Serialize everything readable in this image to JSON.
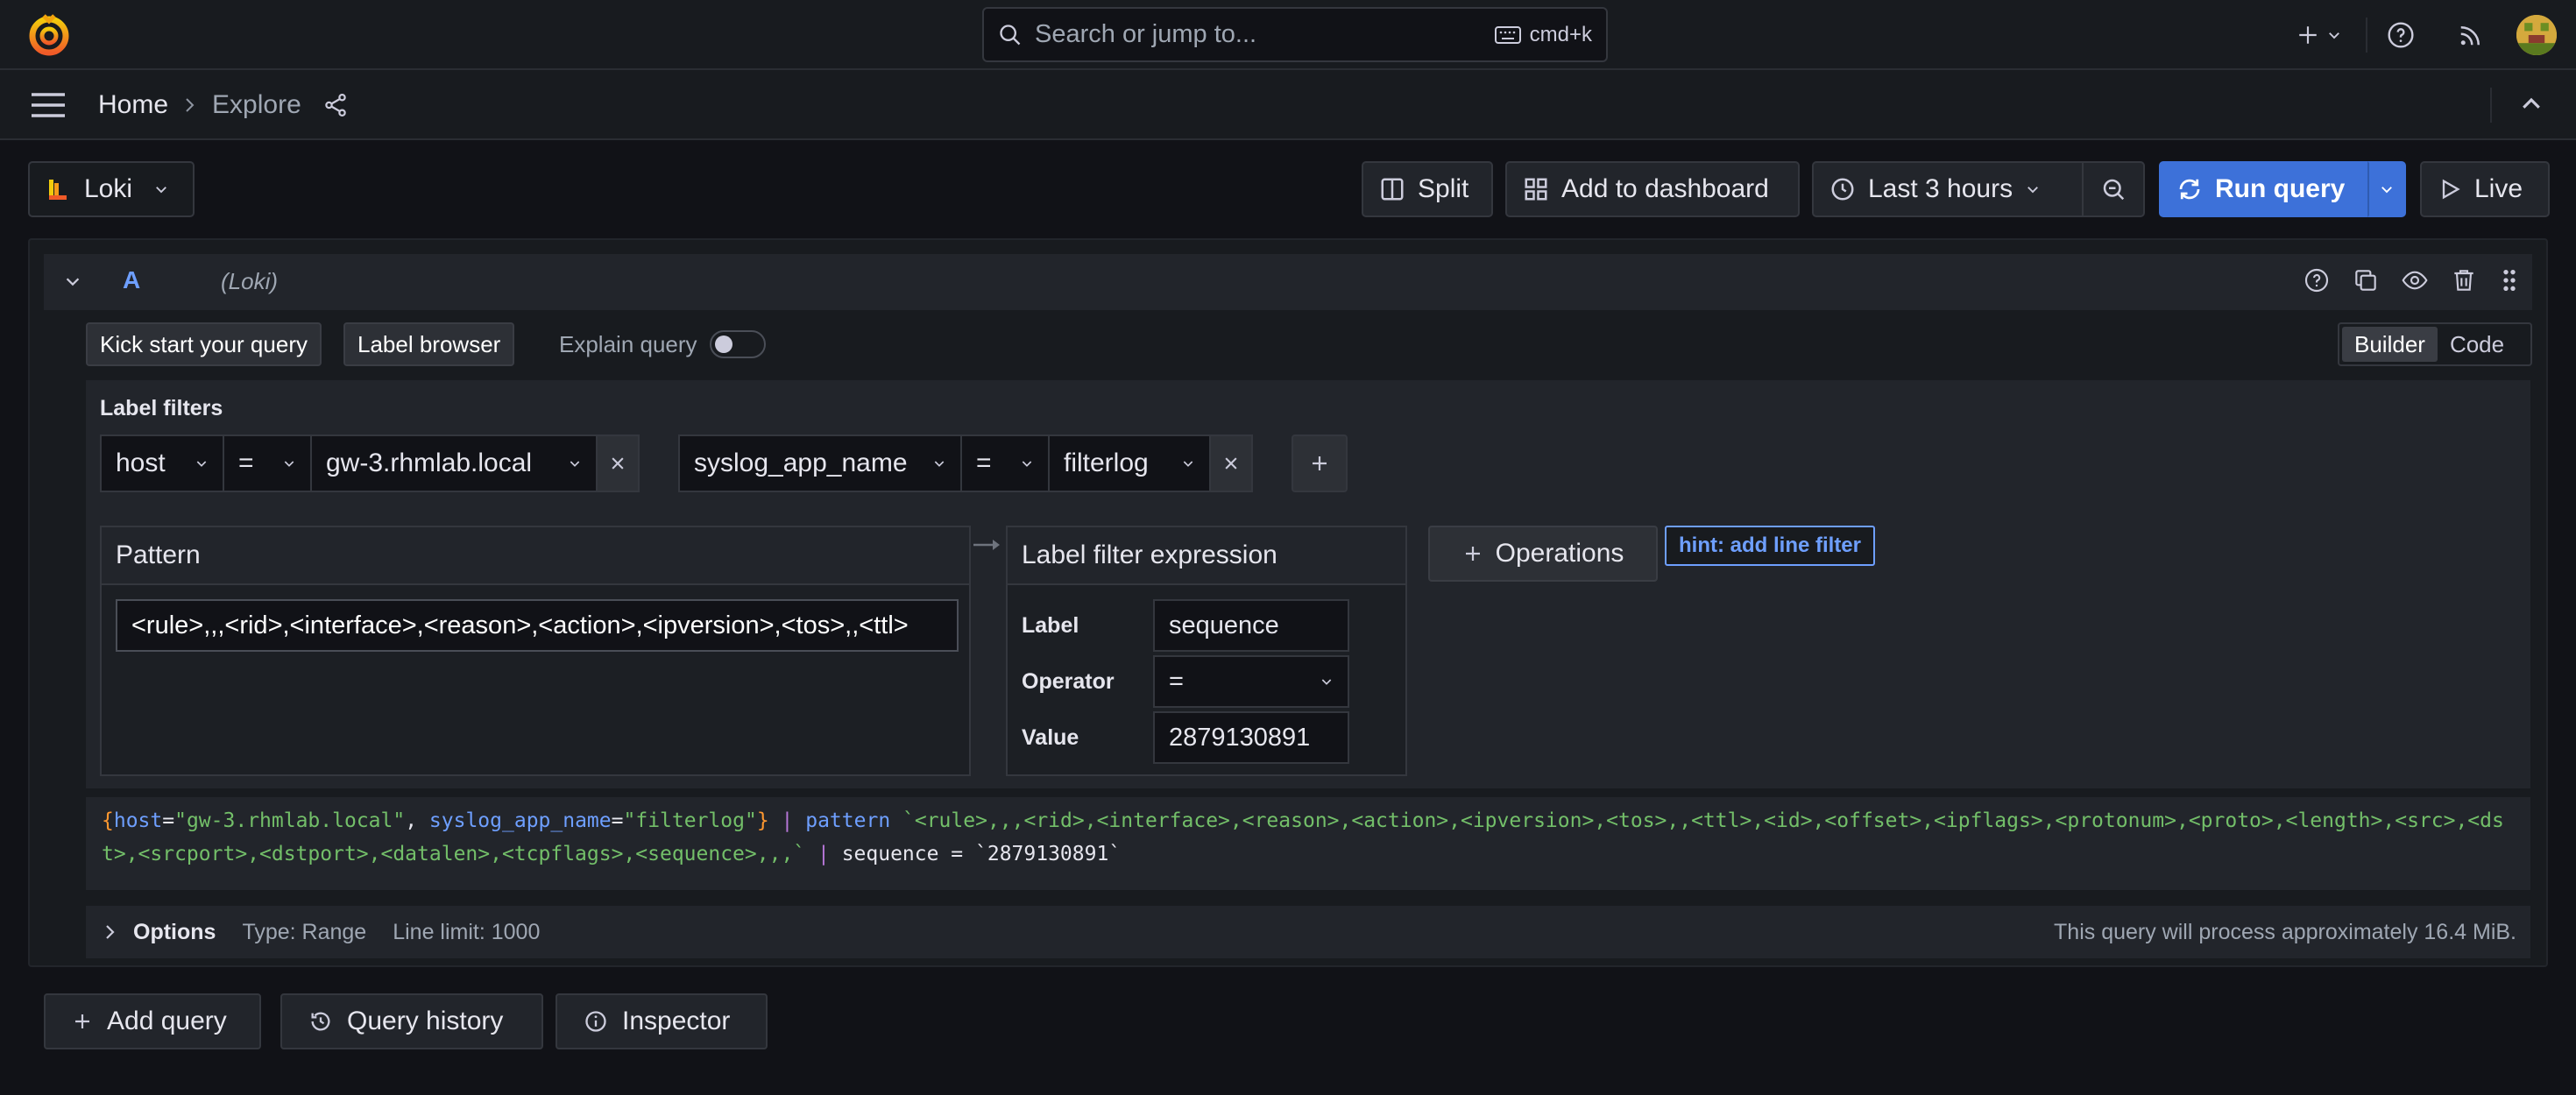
{
  "topbar": {
    "search_placeholder": "Search or jump to...",
    "shortcut": "cmd+k"
  },
  "breadcrumb": {
    "home": "Home",
    "current": "Explore"
  },
  "toolbar": {
    "datasource": "Loki",
    "split": "Split",
    "add_to_dashboard": "Add to dashboard",
    "time_range": "Last 3 hours",
    "run_query": "Run query",
    "live": "Live"
  },
  "query": {
    "ref_id": "A",
    "datasource_label": "(Loki)",
    "kick_start": "Kick start your query",
    "label_browser": "Label browser",
    "explain_query": "Explain query",
    "mode_builder": "Builder",
    "mode_code": "Code",
    "label_filters_title": "Label filters",
    "filters": [
      {
        "label": "host",
        "op": "=",
        "value": "gw-3.rhmlab.local"
      },
      {
        "label": "syslog_app_name",
        "op": "=",
        "value": "filterlog"
      }
    ],
    "pattern_title": "Pattern",
    "pattern_value": "<rule>,,,<rid>,<interface>,<reason>,<action>,<ipversion>,<tos>,,<ttl>",
    "lfe_title": "Label filter expression",
    "lfe_label_name": "Label",
    "lfe_label_value": "sequence",
    "lfe_operator_name": "Operator",
    "lfe_operator_value": "=",
    "lfe_value_name": "Value",
    "lfe_value_value": "2879130891",
    "operations": "Operations",
    "hint": "hint: add line filter",
    "code": {
      "brace_open": "{",
      "k1": "host",
      "eq1": "=",
      "v1": "\"gw-3.rhmlab.local\"",
      "comma": ", ",
      "k2": "syslog_app_name",
      "eq2": "=",
      "v2": "\"filterlog\"",
      "brace_close": "}",
      "pipe1": " | ",
      "kw_pattern": "pattern",
      "pattern_str": " `<rule>,,,<rid>,<interface>,<reason>,<action>,<ipversion>,<tos>,,<ttl>,<id>,<offset>,<ipflags>,<protonum>,<proto>,<length>,<src>,<dst>,<srcport>,<dstport>,<datalen>,<tcpflags>,<sequence>,,,`",
      "pipe2": " | ",
      "tail": "sequence = `2879130891`"
    },
    "options_label": "Options",
    "options_type": "Type: Range",
    "options_limit": "Line limit: 1000",
    "estimate": "This query will process approximately 16.4 MiB."
  },
  "bottom": {
    "add_query": "Add query",
    "query_history": "Query history",
    "inspector": "Inspector"
  },
  "colors": {
    "accent": "#3d71d9",
    "background": "#111217",
    "panel": "#181b1f"
  }
}
